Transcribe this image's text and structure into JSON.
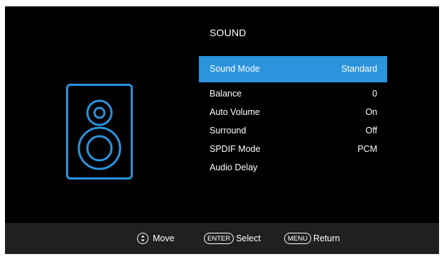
{
  "menu_title": "SOUND",
  "speaker_icon": "speaker-icon",
  "accent_color": "#2b94dc",
  "items": [
    {
      "label": "Sound Mode",
      "value": "Standard",
      "selected": true
    },
    {
      "label": "Balance",
      "value": "0",
      "selected": false
    },
    {
      "label": "Auto Volume",
      "value": "On",
      "selected": false
    },
    {
      "label": "Surround",
      "value": "Off",
      "selected": false
    },
    {
      "label": "SPDIF Mode",
      "value": "PCM",
      "selected": false
    },
    {
      "label": "Audio Delay",
      "value": "",
      "selected": false
    }
  ],
  "footer": {
    "move_label": "Move",
    "enter_key": "ENTER",
    "select_label": "Select",
    "menu_key": "MENU",
    "return_label": "Return"
  }
}
